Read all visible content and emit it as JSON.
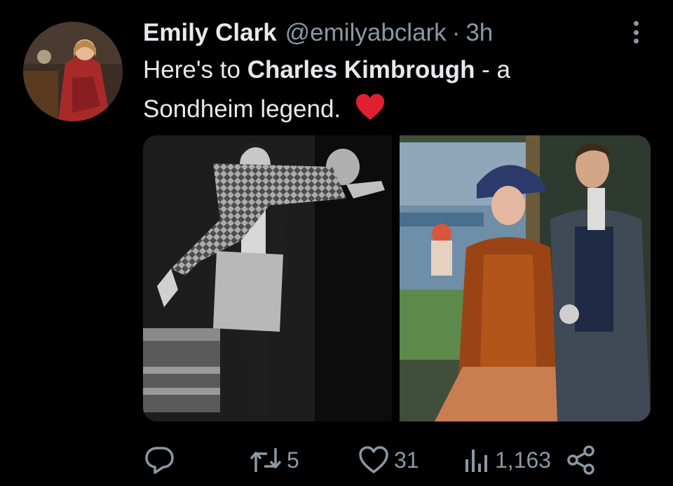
{
  "tweet": {
    "author_name": "Emily Clark",
    "author_handle": "@emilyabclark",
    "separator": "·",
    "time": "3h",
    "text_line1_prefix": "Here's to ",
    "text_line1_bold": "Charles Kimbrough",
    "text_line1_suffix": " - a",
    "text_line2": "Sondheim legend.",
    "emoji": "red-heart"
  },
  "media": [
    {
      "name": "black-and-white-stage-photo"
    },
    {
      "name": "color-stage-costume-photo"
    }
  ],
  "actions": {
    "reply_count": "",
    "retweet_count": "5",
    "like_count": "31",
    "views_count": "1,163"
  },
  "icons": [
    "more-icon",
    "reply-icon",
    "retweet-icon",
    "like-icon",
    "views-icon",
    "share-icon"
  ],
  "colors": {
    "background": "#000000",
    "text": "#e7e9ea",
    "secondary": "#8b98a5",
    "heart": "#e0202e"
  }
}
